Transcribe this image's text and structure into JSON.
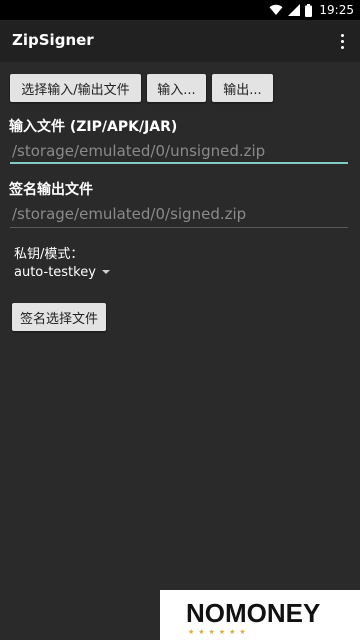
{
  "status_bar": {
    "time": "19:25",
    "icons": [
      "wifi-icon",
      "signal-icon",
      "battery-icon"
    ]
  },
  "app_bar": {
    "title": "ZipSigner",
    "overflow_icon": "more-vert-icon"
  },
  "toolbar": {
    "select_io_label": "选择输入/输出文件",
    "input_label": "输入...",
    "output_label": "输出..."
  },
  "input": {
    "label": "输入文件 (ZIP/APK/JAR)",
    "value": "/storage/emulated/0/unsigned.zip"
  },
  "output": {
    "label": "签名输出文件",
    "value": "/storage/emulated/0/signed.zip"
  },
  "key": {
    "label": "私钥/模式：",
    "selected": "auto-testkey"
  },
  "sign_button_label": "签名选择文件",
  "watermark": {
    "text": "NOMONEY"
  },
  "colors": {
    "background": "#2a2a2a",
    "app_bar": "#212121",
    "accent": "#80cbc4",
    "button": "#e3e3e3",
    "hint_text": "#8a8a8a"
  }
}
